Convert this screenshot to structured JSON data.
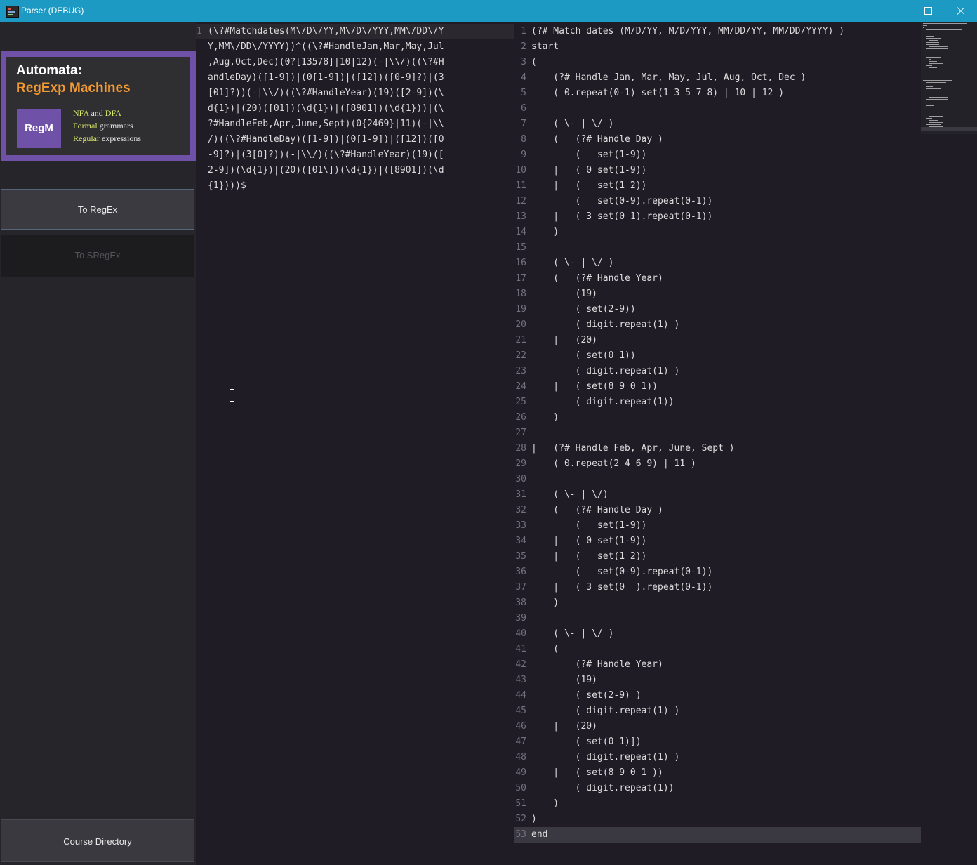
{
  "window": {
    "title": "Parser (DEBUG)"
  },
  "banner": {
    "line1": "Automata:",
    "line2": "RegExp Machines",
    "badge": "RegM",
    "features": [
      {
        "hl": "NFA",
        "rest": " and ",
        "hl2": "DFA"
      },
      {
        "hl": "Formal",
        "rest": " grammars",
        "hl2": ""
      },
      {
        "hl": "Regular",
        "rest": " expressions",
        "hl2": ""
      }
    ]
  },
  "sidebar": {
    "to_regex": "To RegEx",
    "to_sregex": "To SRegEx",
    "course_directory": "Course Directory"
  },
  "left_editor": {
    "line_number": "1",
    "text": "(\\?#Matchdates(M\\/D\\/YY,M\\/D\\/YYY,MM\\/DD\\/YY,MM\\/DD\\/YYYY))^((\\?#HandleJan,Mar,May,Jul,Aug,Oct,Dec)(0?[13578]|10|12)(-|\\\\/)((\\?#HandleDay)([1-9])|(0[1-9])|([12])([0-9]?)|(3[01]?))(-|\\\\/)((\\?#HandleYear)(19)([2-9])(\\d{1})|(20)([01])(\\d{1})|([8901])(\\d{1}))|(\\?#HandleFeb,Apr,June,Sept)(0{2469}|11)(-|\\\\/)((\\?#HandleDay)([1-9])|(0[1-9])|([12])([0-9]?)|(3[0]?))(-|\\\\/)((\\?#HandleYear)(19)([2-9])(\\d{1})|(20)([01\\])(\\d{1})|([8901])(\\d{1})))$"
  },
  "right_editor": {
    "current_line": 53,
    "lines": [
      "(?# Match dates (M/D/YY, M/D/YYY, MM/DD/YY, MM/DD/YYYY) )",
      "start",
      "(",
      "    (?# Handle Jan, Mar, May, Jul, Aug, Oct, Dec )",
      "    ( 0.repeat(0-1) set(1 3 5 7 8) | 10 | 12 )",
      "",
      "    ( \\- | \\/ )",
      "    (   (?# Handle Day )",
      "        (   set(1-9))",
      "    |   ( 0 set(1-9))",
      "    |   (   set(1 2))",
      "        (   set(0-9).repeat(0-1))",
      "    |   ( 3 set(0 1).repeat(0-1))",
      "    )",
      "",
      "    ( \\- | \\/ )",
      "    (   (?# Handle Year)",
      "        (19)",
      "        ( set(2-9))",
      "        ( digit.repeat(1) )",
      "    |   (20)",
      "        ( set(0 1))",
      "        ( digit.repeat(1) )",
      "    |   ( set(8 9 0 1))",
      "        ( digit.repeat(1))",
      "    )",
      "",
      "|   (?# Handle Feb, Apr, June, Sept )",
      "    ( 0.repeat(2 4 6 9) | 11 )",
      "",
      "    ( \\- | \\/)",
      "    (   (?# Handle Day )",
      "        (   set(1-9))",
      "    |   ( 0 set(1-9))",
      "    |   (   set(1 2))",
      "        (   set(0-9).repeat(0-1))",
      "    |   ( 3 set(0  ).repeat(0-1))",
      "    )",
      "",
      "    ( \\- | \\/ )",
      "    (",
      "        (?# Handle Year)",
      "        (19)",
      "        ( set(2-9) )",
      "        ( digit.repeat(1) )",
      "    |   (20)",
      "        ( set(0 1)])",
      "        ( digit.repeat(1) )",
      "    |   ( set(8 9 0 1 ))",
      "        ( digit.repeat(1))",
      "    )",
      ")",
      "end"
    ]
  },
  "colors": {
    "titlebar": "#1c9ac4",
    "banner_frame": "#6f52a8",
    "banner_accent": "#f29a31",
    "feature_highlight": "#d9e86a",
    "editor_bg": "#1f1c26"
  }
}
